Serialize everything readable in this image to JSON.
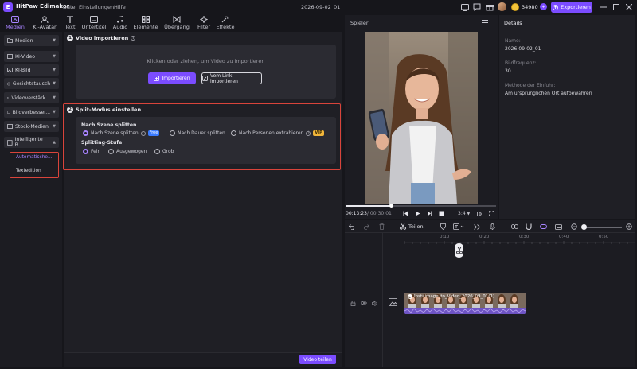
{
  "app": {
    "name": "HitPaw Edimakor",
    "menu": [
      "Datei",
      "Einstellungen",
      "Hilfe"
    ],
    "document": "2026-09-02_01",
    "credits": "34980",
    "export_label": "Exportieren"
  },
  "toolbar": {
    "tools": [
      {
        "label": "Medien",
        "icon": "media-icon",
        "active": true
      },
      {
        "label": "KI-Avatar",
        "icon": "avatar-icon"
      },
      {
        "label": "Text",
        "icon": "text-icon"
      },
      {
        "label": "Untertitel",
        "icon": "subtitle-icon"
      },
      {
        "label": "Audio",
        "icon": "music-icon"
      },
      {
        "label": "Elemente",
        "icon": "elements-icon"
      },
      {
        "label": "Übergang",
        "icon": "transition-icon"
      },
      {
        "label": "Filter",
        "icon": "filter-icon"
      },
      {
        "label": "Effekte",
        "icon": "effects-icon"
      }
    ]
  },
  "sidebar": {
    "categories": [
      {
        "label": "Medien"
      },
      {
        "label": "KI-Video"
      },
      {
        "label": "KI-Bild"
      },
      {
        "label": "Gesichtstausch"
      },
      {
        "label": "Videoverstärk..."
      },
      {
        "label": "Bildverbesser..."
      },
      {
        "label": "Stock-Medien"
      },
      {
        "label": "Intelligente B..."
      }
    ],
    "sub_items": [
      "Automatische...",
      "Textedition"
    ]
  },
  "import_section": {
    "step": "1",
    "title": "Video importieren",
    "drop_text": "Klicken oder ziehen, um Video zu importieren",
    "import_button": "Importieren",
    "link_button": "Vom Link importieren"
  },
  "split_section": {
    "step": "2",
    "title": "Split-Modus einstellen",
    "group_label": "Nach Szene splitten",
    "options": [
      "Nach Szene splitten",
      "Nach Dauer splitten",
      "Nach Personen extrahieren"
    ],
    "free_tag": "Free",
    "vip_tag": "VIP",
    "level_label": "Splitting-Stufe",
    "levels": [
      "Fein",
      "Ausgewogen",
      "Grob"
    ]
  },
  "split_button": "Video teilen",
  "player": {
    "label": "Spieler",
    "current_time": "00:13:23",
    "total_time": "/ 00:30:01",
    "aspect": "3:4",
    "progress": 0.3
  },
  "details": {
    "tab": "Details",
    "fields": [
      {
        "key": "Name:",
        "value": "2026-09-02_01"
      },
      {
        "key": "Bildfrequenz:",
        "value": "30"
      },
      {
        "key": "Methode der Einfuhr:",
        "value": "Am ursprünglichen Ort aufbewahren"
      }
    ]
  },
  "timeline": {
    "split_label": "Teilen",
    "ruler": [
      "0:10",
      "0:20",
      "0:30",
      "0:40",
      "0:50"
    ],
    "clip_name": "Instaimage_to_Video_2026_09_01(1)"
  }
}
